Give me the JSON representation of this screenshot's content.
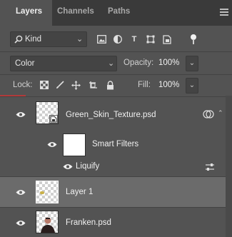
{
  "tabs": [
    {
      "label": "Layers",
      "active": true
    },
    {
      "label": "Channels",
      "active": false
    },
    {
      "label": "Paths",
      "active": false
    }
  ],
  "filter": {
    "kind_label": "Kind",
    "icons": [
      "image-filter-icon",
      "adjustment-filter-icon",
      "type-filter-icon",
      "shape-filter-icon",
      "smart-object-filter-icon"
    ],
    "type_icon_glyph": "T"
  },
  "blend": {
    "mode": "Color",
    "opacity_label": "Opacity:",
    "opacity_value": "100%"
  },
  "lock": {
    "label": "Lock:",
    "icons": [
      "lock-transparent-icon",
      "lock-brush-icon",
      "lock-move-icon",
      "lock-artboard-icon",
      "lock-all-icon"
    ],
    "fill_label": "Fill:",
    "fill_value": "100%"
  },
  "layers": [
    {
      "name": "Green_Skin_Texture.psd",
      "type": "smart-object",
      "visible": true,
      "selected": false
    },
    {
      "name": "Smart Filters",
      "type": "smart-filters",
      "visible": true,
      "selected": false
    },
    {
      "name": "Liquify",
      "type": "filter",
      "visible": true,
      "selected": false
    },
    {
      "name": "Layer 1",
      "type": "pixel",
      "visible": true,
      "selected": true
    },
    {
      "name": "Franken.psd",
      "type": "pixel",
      "visible": true,
      "selected": false
    }
  ],
  "colors": {
    "panel_bg": "#535353",
    "tabbar_bg": "#3a3a3a",
    "selected_row": "#6b6b6b",
    "accent_red": "#b13a3a"
  }
}
